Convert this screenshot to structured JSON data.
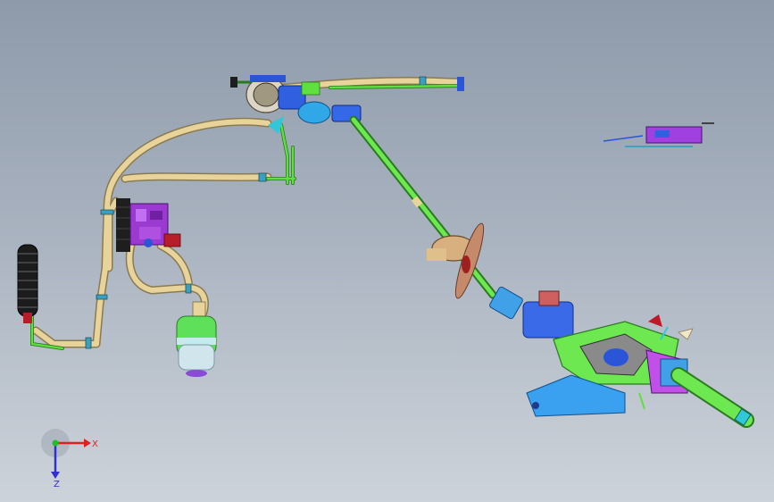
{
  "viewport": {
    "background_top": "#8e9aaa",
    "background_bottom": "#cdd3da"
  },
  "triad": {
    "x_label": "X",
    "z_label": "Z",
    "x_color": "#e02020",
    "y_color": "#20c020",
    "z_color": "#3030d0"
  },
  "model": {
    "hose_color": "#e8d49a",
    "pipe_color": "#60e040",
    "housing_color": "#2a55d8",
    "bracket_color": "#7bd84a",
    "module_color": "#9a3ad0",
    "accent_red": "#b81e2a",
    "dark_color": "#1e1e1e",
    "cyan_color": "#30c8d8",
    "icon": "steering-column-assembly-icon"
  }
}
